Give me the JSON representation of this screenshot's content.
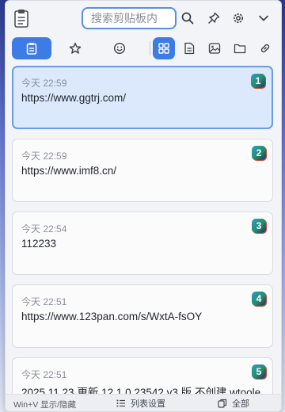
{
  "search": {
    "placeholder": "搜索剪贴板内"
  },
  "titlebar": {
    "icons": [
      "clipboard-app-icon",
      "search-icon",
      "pin-icon",
      "gear-icon",
      "chevron-down-icon"
    ]
  },
  "toolbar": {
    "active_tab": "clipboard",
    "tabs_left": [
      "clipboard-icon",
      "star-icon",
      "smiley-icon"
    ],
    "filters_right": [
      "grid-icon",
      "text-document-icon",
      "image-icon",
      "folder-icon",
      "link-icon"
    ],
    "accent_color": "#3d7be5"
  },
  "items": [
    {
      "time": "今天 22:59",
      "content": "https://www.ggtrj.com/",
      "index": "1",
      "selected": true
    },
    {
      "time": "今天 22:59",
      "content": "https://www.imf8.cn/",
      "index": "2",
      "selected": false
    },
    {
      "time": "今天 22:54",
      "content": "112233",
      "index": "3",
      "selected": false
    },
    {
      "time": "今天 22:51",
      "content": "https://www.123pan.com/s/WxtA-fsOY",
      "index": "4",
      "selected": false
    },
    {
      "time": "今天 22:51",
      "content": "2025.11.23 更新 12.1.0.23542 v3 版 不创建 wtoole",
      "index": "5",
      "selected": false
    }
  ],
  "statusbar": {
    "hotkey_hint": "Win+V 显示/隐藏",
    "list_settings": "列表设置",
    "filter_all": "全部"
  }
}
